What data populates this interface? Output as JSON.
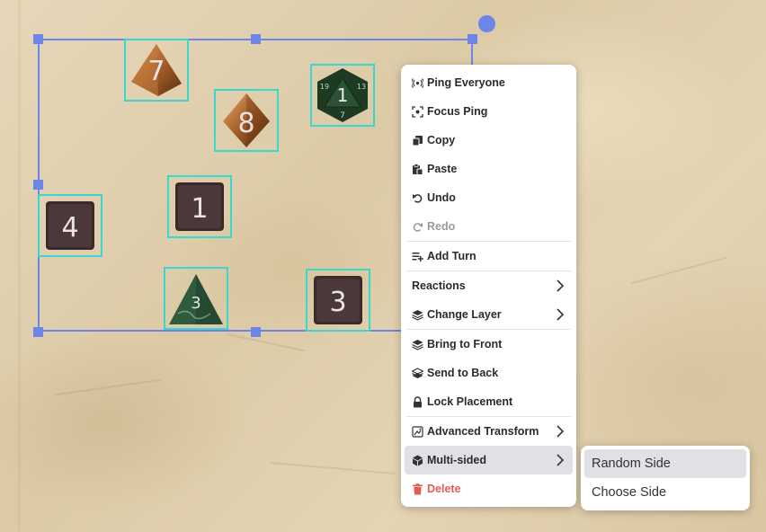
{
  "dice": {
    "d4_orange": "7",
    "d8_orange": "8",
    "d20_green": "1",
    "d20_green_small_a": "19",
    "d20_green_small_b": "13",
    "d20_green_small_c": "7",
    "d6_left": "4",
    "d6_center": "1",
    "d4_green": "3",
    "d6_right": "3"
  },
  "context_menu": {
    "ping_everyone": "Ping Everyone",
    "focus_ping": "Focus Ping",
    "copy": "Copy",
    "paste": "Paste",
    "undo": "Undo",
    "redo": "Redo",
    "add_turn": "Add Turn",
    "reactions": "Reactions",
    "change_layer": "Change Layer",
    "bring_to_front": "Bring to Front",
    "send_to_back": "Send to Back",
    "lock_placement": "Lock Placement",
    "advanced_transform": "Advanced Transform",
    "multi_sided": "Multi-sided",
    "delete": "Delete"
  },
  "submenu": {
    "random_side": "Random Side",
    "choose_side": "Choose Side"
  },
  "colors": {
    "selection": "#6b86e8",
    "token_outline": "#3ad6d0",
    "danger": "#e25b5b",
    "hover": "#dfe1e5"
  }
}
